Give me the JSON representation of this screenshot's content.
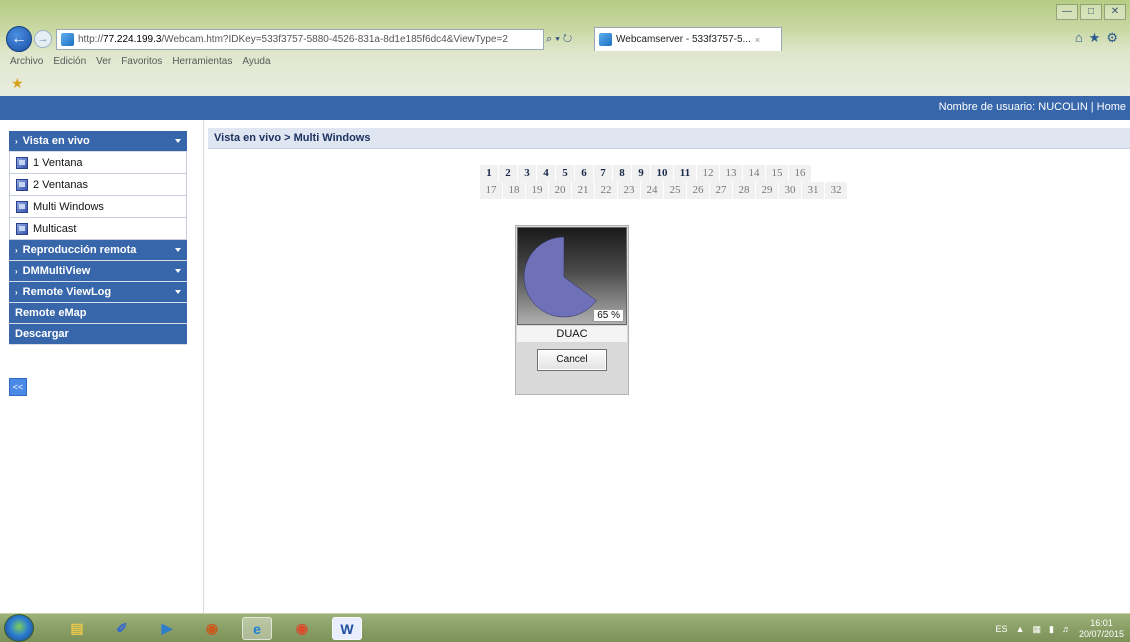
{
  "browser": {
    "url_prefix": "http://",
    "url_host": "77.224.199.3",
    "url_rest": "/Webcam.htm?IDKey=533f3757-5880-4526-831a-8d1e185f6dc4&ViewType=2",
    "tab_title": "Webcamserver - 533f3757-5...",
    "tab_close": "×",
    "addr_tools": "⌕ ▾ ↻",
    "menu": [
      "Archivo",
      "Edición",
      "Ver",
      "Favoritos",
      "Herramientas",
      "Ayuda"
    ],
    "win_minimize": "—",
    "win_maximize": "□",
    "win_close": "✕",
    "chrome_icons": "⌂★⚙"
  },
  "topbar": {
    "user_label": "Nombre de usuario: NUCOLIN",
    "separator": "|",
    "home_link": "Home"
  },
  "sidebar": {
    "section_live": "Vista en vivo",
    "live_items": [
      "1 Ventana",
      "2 Ventanas",
      "Multi Windows",
      "Multicast"
    ],
    "section_playback": "Reproducción remota",
    "section_dmmultiview": "DMMultiView",
    "section_viewlog": "Remote ViewLog",
    "section_emap": "Remote eMap",
    "section_download": "Descargar",
    "collapse_label": "<<"
  },
  "main": {
    "breadcrumb": "Vista en vivo > Multi Windows",
    "pages_row1": [
      "1",
      "2",
      "3",
      "4",
      "5",
      "6",
      "7",
      "8",
      "9",
      "10",
      "11",
      "12",
      "13",
      "14",
      "15",
      "16"
    ],
    "pages_row2": [
      "17",
      "18",
      "19",
      "20",
      "21",
      "22",
      "23",
      "24",
      "25",
      "26",
      "27",
      "28",
      "29",
      "30",
      "31",
      "32"
    ],
    "pages_bold": [
      "1",
      "2",
      "3",
      "4",
      "5",
      "6",
      "7",
      "8",
      "9",
      "10",
      "11"
    ],
    "viewer": {
      "progress_percent": 65,
      "progress_label": "65 %",
      "camera_name": "DUAC",
      "cancel_label": "Cancel",
      "pie_color": "#6e70b8"
    }
  },
  "taskbar": {
    "apps": [
      "explorer",
      "paint",
      "media",
      "webcam",
      "internet-explorer",
      "chrome",
      "word"
    ],
    "word_label": "W",
    "lang": "ES",
    "time": "16:01",
    "date": "20/07/2015"
  }
}
